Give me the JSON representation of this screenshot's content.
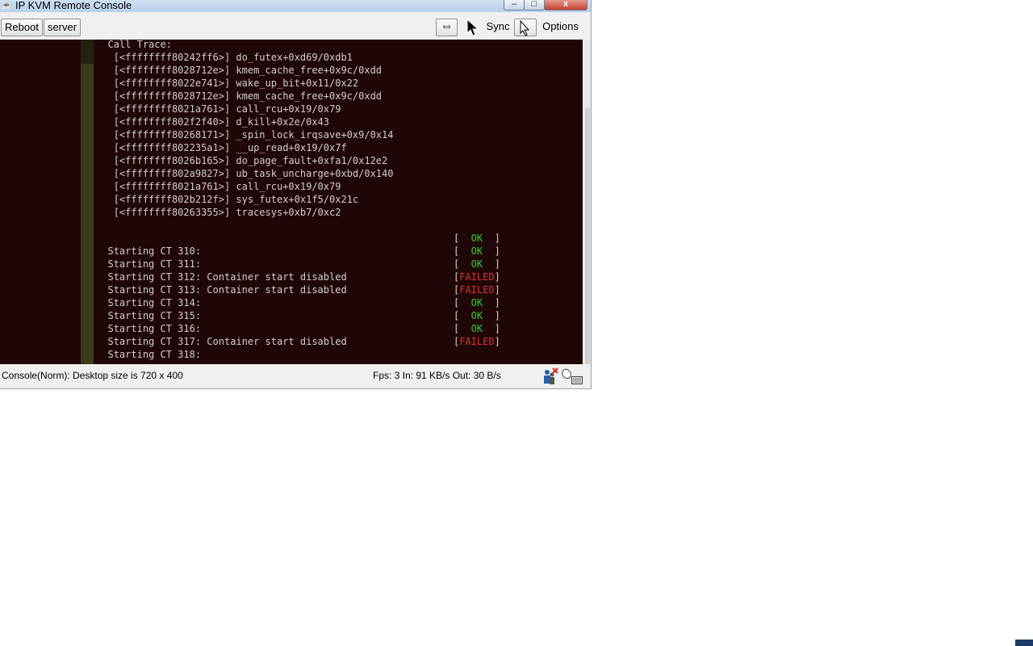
{
  "window": {
    "title": "IP KVM Remote Console",
    "minimize": "–",
    "maximize": "□",
    "close": "x"
  },
  "toolbar": {
    "reboot_label": "Reboot",
    "server_label": "server",
    "fit_symbol": "⇔",
    "sync_label": "Sync",
    "options_label": "Options"
  },
  "console": {
    "lines": [
      "           Call Trace:",
      "            [<ffffffff80242ff6>] do_futex+0xd69/0xdb1",
      "            [<ffffffff8028712e>] kmem_cache_free+0x9c/0xdd",
      "            [<ffffffff8022e741>] wake_up_bit+0x11/0x22",
      "            [<ffffffff8028712e>] kmem_cache_free+0x9c/0xdd",
      "            [<ffffffff8021a761>] call_rcu+0x19/0x79",
      "            [<ffffffff802f2f40>] d_kill+0x2e/0x43",
      "            [<ffffffff80268171>] _spin_lock_irqsave+0x9/0x14",
      "            [<ffffffff802235a1>] __up_read+0x19/0x7f",
      "            [<ffffffff8026b165>] do_page_fault+0xfa1/0x12e2",
      "            [<ffffffff802a9827>] ub_task_uncharge+0xbd/0x140",
      "            [<ffffffff8021a761>] call_rcu+0x19/0x79",
      "            [<ffffffff802b212f>] sys_futex+0x1f5/0x21c",
      "            [<ffffffff80263355>] tracesys+0xb7/0xc2",
      "",
      "",
      "           Starting CT 310:",
      "           Starting CT 311:",
      "           Starting CT 312: Container start disabled",
      "           Starting CT 313: Container start disabled",
      "           Starting CT 314:",
      "           Starting CT 315:",
      "           Starting CT 316:",
      "           Starting CT 317: Container start disabled",
      "           Starting CT 318:"
    ],
    "status_marks": [
      {
        "line": 15,
        "text": "OK",
        "kind": "ok"
      },
      {
        "line": 16,
        "text": "OK",
        "kind": "ok"
      },
      {
        "line": 17,
        "text": "OK",
        "kind": "ok"
      },
      {
        "line": 18,
        "text": "FAILED",
        "kind": "failed"
      },
      {
        "line": 19,
        "text": "FAILED",
        "kind": "failed"
      },
      {
        "line": 20,
        "text": "OK",
        "kind": "ok"
      },
      {
        "line": 21,
        "text": "OK",
        "kind": "ok"
      },
      {
        "line": 22,
        "text": "OK",
        "kind": "ok"
      },
      {
        "line": 23,
        "text": "FAILED",
        "kind": "failed"
      }
    ]
  },
  "status_bar": {
    "left_text": "Console(Norm): Desktop size is 720 x 400",
    "right_text": "Fps: 3 In: 91 KB/s Out: 30 B/s"
  },
  "colors": {
    "console_bg": "#200707",
    "ok": "#2fcf2f",
    "failed": "#e03030"
  }
}
